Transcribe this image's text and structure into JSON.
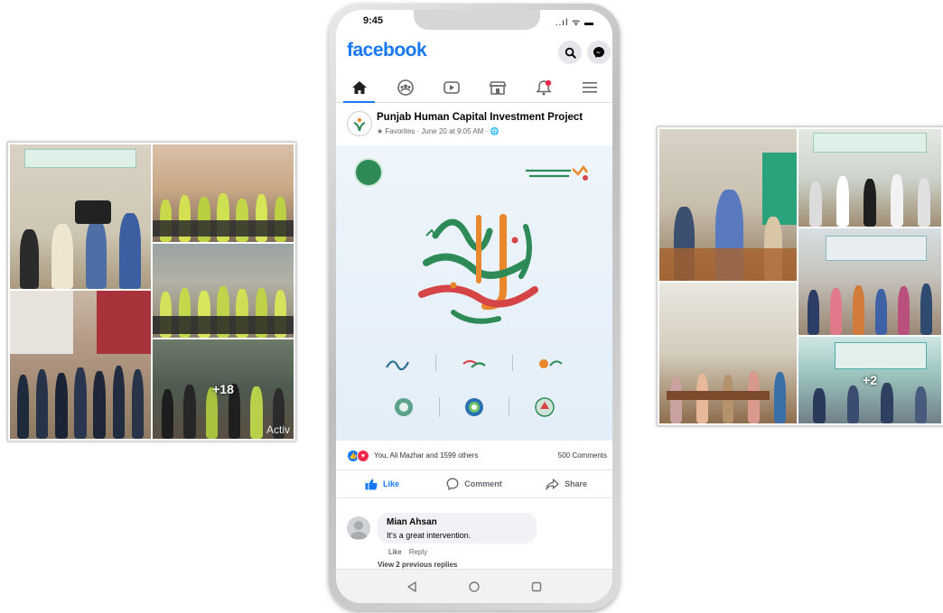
{
  "left_collage": {
    "more_count": "+18",
    "watermark": "Activ"
  },
  "right_collage": {
    "more_count": "+2"
  },
  "status_bar": {
    "time": "9:45",
    "icons": "..ıl ᯤ ▬"
  },
  "app": {
    "logo_text": "facebook",
    "header_buttons": [
      "search-icon",
      "messenger-icon"
    ],
    "nav_tabs": [
      {
        "icon": "home-icon",
        "active": true
      },
      {
        "icon": "groups-icon",
        "active": false
      },
      {
        "icon": "watch-icon",
        "active": false
      },
      {
        "icon": "marketplace-icon",
        "active": false
      },
      {
        "icon": "notifications-icon",
        "active": false
      },
      {
        "icon": "menu-icon",
        "active": false
      }
    ]
  },
  "post": {
    "page_name": "Punjab Human Capital Investment Project",
    "meta": "★ Favorites · June 20 at 9:05 AM · 🌐",
    "reactions_text": "You, Ali Mazhar and 1599 others",
    "comments_count": "500 Comments",
    "actions": {
      "like": "Like",
      "comment": "Comment",
      "share": "Share"
    }
  },
  "comment": {
    "author": "Mian Ahsan",
    "text": "It's a great intervention.",
    "like_label": "Like",
    "reply_label": "Reply",
    "view_replies": "View 2 previous replies"
  },
  "colors": {
    "brand": "#1877f2",
    "like_reaction": "#1877f2",
    "love_reaction": "#f02849",
    "calligraphy_green": "#2e8b57",
    "calligraphy_orange": "#e8872b",
    "calligraphy_red": "#d64545"
  }
}
